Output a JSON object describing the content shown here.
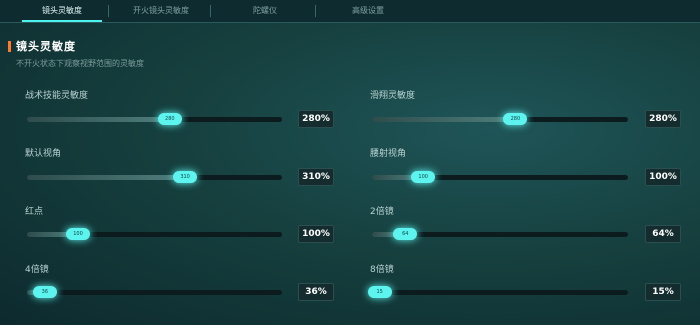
{
  "tabs": [
    {
      "label": "镜头灵敏度",
      "active": true
    },
    {
      "label": "开火镜头灵敏度",
      "active": false
    },
    {
      "label": "陀螺仪",
      "active": false
    },
    {
      "label": "高级设置",
      "active": false
    }
  ],
  "section": {
    "title": "镜头灵敏度",
    "description": "不开火状态下观察视野范围的灵敏度"
  },
  "settings": [
    {
      "label": "战术技能灵敏度",
      "value": "280%",
      "handle_text": "280",
      "percent": 0.56
    },
    {
      "label": "滑翔灵敏度",
      "value": "280%",
      "handle_text": "280",
      "percent": 0.56
    },
    {
      "label": "默认视角",
      "value": "310%",
      "handle_text": "310",
      "percent": 0.62
    },
    {
      "label": "腰射视角",
      "value": "100%",
      "handle_text": "100",
      "percent": 0.2
    },
    {
      "label": "红点",
      "value": "100%",
      "handle_text": "100",
      "percent": 0.2
    },
    {
      "label": "2倍镜",
      "value": "64%",
      "handle_text": "64",
      "percent": 0.13
    },
    {
      "label": "4倍镜",
      "value": "36%",
      "handle_text": "36",
      "percent": 0.07
    },
    {
      "label": "8倍镜",
      "value": "15%",
      "handle_text": "15",
      "percent": 0.03
    }
  ],
  "colors": {
    "accent": "#5df4ef",
    "section_marker": "#ff7a2a",
    "background": "#16403f"
  }
}
